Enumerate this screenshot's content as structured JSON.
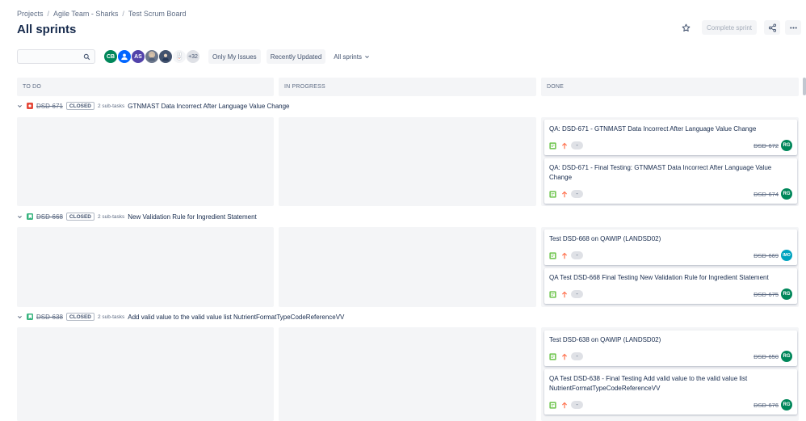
{
  "breadcrumb": {
    "items": [
      "Projects",
      "Agile Team - Sharks",
      "Test Scrum Board"
    ],
    "separator": "/"
  },
  "page_title": "All sprints",
  "header_actions": {
    "complete_sprint": "Complete sprint"
  },
  "toolbar": {
    "search_placeholder": "",
    "avatars": [
      {
        "initials": "CB",
        "color": "#00875a"
      },
      {
        "initials": "",
        "color": "#0065ff",
        "icon": "person-icon"
      },
      {
        "initials": "AS",
        "color": "#5243aa"
      },
      {
        "initials": "",
        "color": "#6b778c",
        "icon": "photo-avatar"
      },
      {
        "initials": "",
        "color": "#42526e",
        "icon": "photo-avatar"
      },
      {
        "initials": "",
        "color": "#f4f5f7",
        "icon": "bunny-avatar"
      }
    ],
    "more_count": "+32",
    "only_my_issues": "Only My Issues",
    "recently_updated": "Recently Updated",
    "sprint_filter": "All sprints"
  },
  "columns": [
    "TO DO",
    "IN PROGRESS",
    "DONE"
  ],
  "swimlanes": [
    {
      "key": "DSD-671",
      "type": "bug",
      "type_color": "#e5493a",
      "status": "CLOSED",
      "subtasks": "2 sub-tasks",
      "summary": "GTNMAST Data Incorrect After Language Value Change",
      "cards": [
        {
          "title": "QA: DSD-671 - GTNMAST Data Incorrect After Language Value Change",
          "estimate": "-",
          "key": "DSD-672",
          "assignee": "RG",
          "assignee_color": "#00875a"
        },
        {
          "title": "QA: DSD-671 - Final Testing: GTNMAST Data Incorrect After Language Value Change",
          "estimate": "-",
          "key": "DSD-674",
          "assignee": "RG",
          "assignee_color": "#00875a"
        }
      ]
    },
    {
      "key": "DSD-668",
      "type": "story",
      "type_color": "#36b37e",
      "status": "CLOSED",
      "subtasks": "2 sub-tasks",
      "summary": "New Validation Rule for Ingredient Statement",
      "cards": [
        {
          "title": "Test DSD-668 on QAWIP (LANDSD02)",
          "estimate": "-",
          "key": "DSD-669",
          "assignee": "IMO",
          "assignee_color": "#00a3bf"
        },
        {
          "title": "QA Test DSD-668 Final Testing New Validation Rule for Ingredient Statement",
          "estimate": "-",
          "key": "DSD-675",
          "assignee": "RG",
          "assignee_color": "#00875a"
        }
      ]
    },
    {
      "key": "DSD-638",
      "type": "story",
      "type_color": "#36b37e",
      "status": "CLOSED",
      "subtasks": "2 sub-tasks",
      "summary": "Add valid value to the valid value list NutrientFormatTypeCodeReferenceVV",
      "cards": [
        {
          "title": "Test DSD-638 on QAWIP (LANDSD02)",
          "estimate": "-",
          "key": "DSD-650",
          "assignee": "RG",
          "assignee_color": "#00875a"
        },
        {
          "title": "QA Test DSD-638 - Final Testing Add valid value to the valid value list NutrientFormatTypeCodeReferenceVV",
          "estimate": "-",
          "key": "DSD-676",
          "assignee": "RG",
          "assignee_color": "#00875a"
        }
      ]
    }
  ],
  "colors": {
    "priority_arrow": "#ff7452",
    "subtask_icon": "#6bc34a",
    "column_bg": "#f4f5f7"
  }
}
